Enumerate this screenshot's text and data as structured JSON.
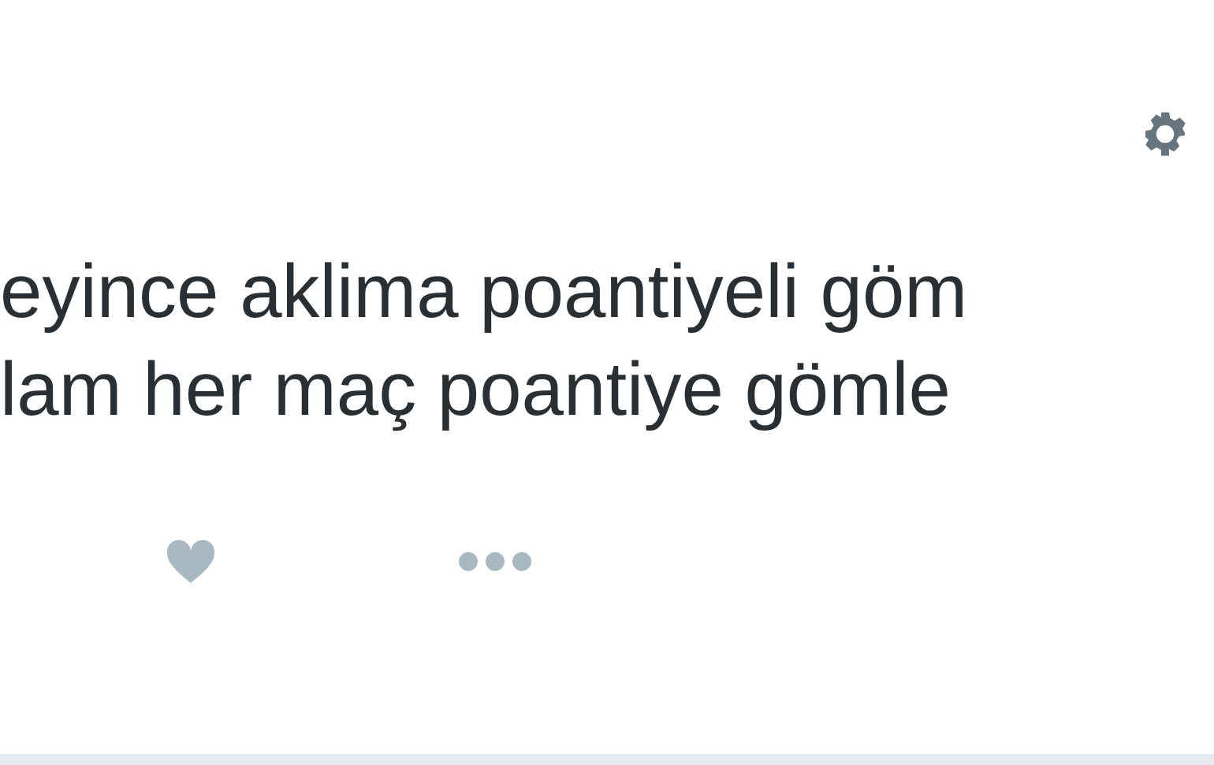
{
  "tweet_text_lines": [
    "eyince aklima poantiyeli göm",
    "lam her maç poantiye gömle"
  ]
}
